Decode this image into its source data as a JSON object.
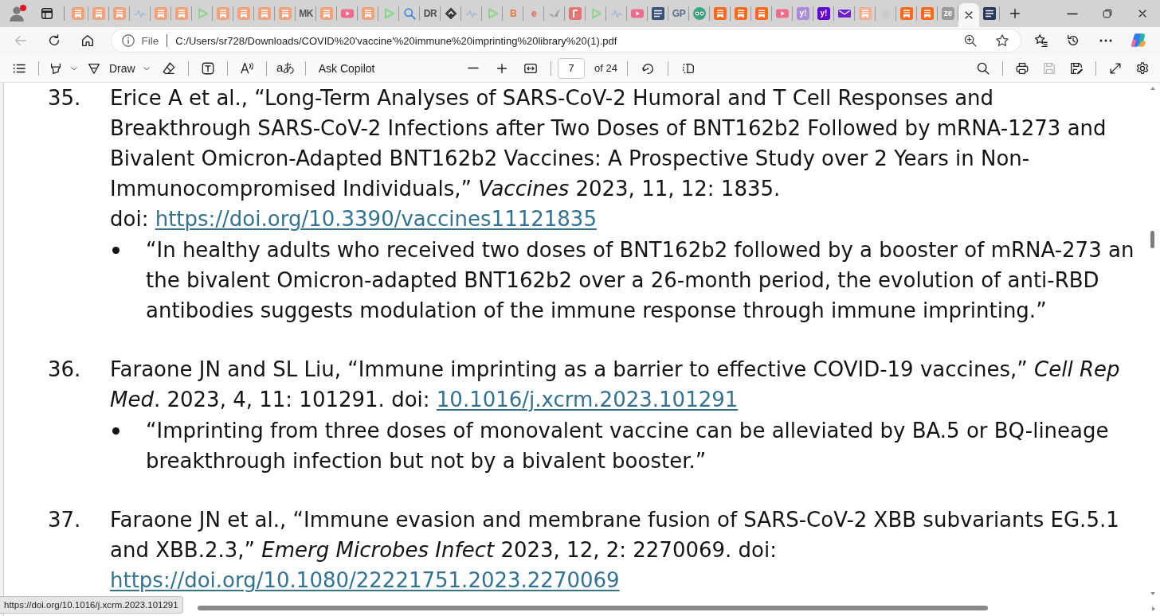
{
  "browser": {
    "profile": {
      "notification": true
    },
    "tabs": [
      {
        "kind": "bookmark",
        "color": "#f4a27a",
        "selected": false
      },
      {
        "kind": "bookmark",
        "color": "#f4a27a",
        "selected": false
      },
      {
        "kind": "bookmark",
        "color": "#f4a27a",
        "selected": false
      },
      {
        "kind": "pulse",
        "color": "#a8b8d8",
        "selected": false
      },
      {
        "kind": "bookmark",
        "color": "#f4a27a",
        "selected": false
      },
      {
        "kind": "bookmark",
        "color": "#f4a27a",
        "selected": false
      },
      {
        "kind": "play",
        "color": "#8fd48c",
        "selected": false
      },
      {
        "kind": "bookmark",
        "color": "#f4a27a",
        "selected": false
      },
      {
        "kind": "bookmark",
        "color": "#f4a27a",
        "selected": false
      },
      {
        "kind": "bookmark",
        "color": "#f4a27a",
        "selected": false
      },
      {
        "kind": "bookmark",
        "color": "#f4a27a",
        "selected": false
      },
      {
        "kind": "letters",
        "text": "MK",
        "color": "#555555",
        "selected": false
      },
      {
        "kind": "bookmark",
        "color": "#f4a27a",
        "selected": false
      },
      {
        "kind": "video",
        "color": "#ee6b8b",
        "selected": false
      },
      {
        "kind": "bookmark",
        "color": "#f4a27a",
        "selected": false
      },
      {
        "kind": "play",
        "color": "#8fd48c",
        "selected": false
      },
      {
        "kind": "search",
        "color": "#4a8ad4",
        "selected": false
      },
      {
        "kind": "letters",
        "text": "DR",
        "color": "#4d4d4d",
        "selected": false
      },
      {
        "kind": "diamond",
        "color": "#3c3c3c",
        "selected": false
      },
      {
        "kind": "pulse",
        "color": "#a8b8d8",
        "selected": false
      },
      {
        "kind": "play",
        "color": "#8fd48c",
        "selected": false
      },
      {
        "kind": "letters",
        "text": "B",
        "color": "#e8773e",
        "selected": false
      },
      {
        "kind": "letters",
        "text": "e",
        "color": "#e2675c",
        "selected": false
      },
      {
        "kind": "bird",
        "color": "#a0a0a0",
        "selected": false
      },
      {
        "kind": "tile",
        "color": "#e57373",
        "selected": false
      },
      {
        "kind": "play",
        "color": "#8fd48c",
        "selected": false
      },
      {
        "kind": "pulse",
        "color": "#a8b8d8",
        "selected": false
      },
      {
        "kind": "video",
        "color": "#ee6b8b",
        "selected": false
      },
      {
        "kind": "news",
        "color": "#3a4f7a",
        "selected": false
      },
      {
        "kind": "letters",
        "text": "GP",
        "color": "#5a6f8c",
        "selected": false
      },
      {
        "kind": "owl",
        "color": "#3aa583",
        "selected": false
      },
      {
        "kind": "bookmark",
        "color": "#ff6719",
        "selected": false
      },
      {
        "kind": "bookmark",
        "color": "#ff6719",
        "selected": false
      },
      {
        "kind": "bookmark",
        "color": "#ff6719",
        "selected": false
      },
      {
        "kind": "video",
        "color": "#ee6b8b",
        "selected": false
      },
      {
        "kind": "letter-tile",
        "text": "y!",
        "color": "#a98bdb",
        "selected": false
      },
      {
        "kind": "letter-tile",
        "text": "y!",
        "color": "#6001d2",
        "selected": false
      },
      {
        "kind": "mail",
        "color": "#6a1fd0",
        "selected": false
      },
      {
        "kind": "bookmark",
        "color": "#f4b08f",
        "selected": false
      },
      {
        "kind": "cross",
        "color": "#c9c9c9",
        "selected": false
      },
      {
        "kind": "bookmark",
        "color": "#ff6719",
        "selected": false
      },
      {
        "kind": "bookmark",
        "color": "#ff6719",
        "selected": false
      },
      {
        "kind": "letter-tile",
        "text": "ze",
        "color": "#9a9a9a",
        "selected": false
      },
      {
        "selected": true
      },
      {
        "kind": "news",
        "color": "#26365e",
        "selected": false
      }
    ]
  },
  "address_bar": {
    "back": {
      "disabled": true
    },
    "scheme": "File",
    "url": "C:/Users/sr728/Downloads/COVID%20'vaccine'%20immune%20imprinting%20library%20(1).pdf"
  },
  "pdf_toolbar": {
    "draw_label": "Draw",
    "translate_label": "aあ",
    "copilot_label": "Ask Copilot",
    "page": "7",
    "page_total": "of 24",
    "save": {
      "disabled": true
    }
  },
  "document": {
    "references": [
      {
        "number": "35.",
        "lines": [
          {
            "text": "Erice A et al., “Long-Term Analyses of SARS-CoV-2 Humoral and T Cell Responses and"
          },
          {
            "text": "Breakthrough SARS-CoV-2 Infections after Two Doses of BNT162b2 Followed by mRNA-1273 and"
          },
          {
            "text": "Bivalent Omicron-Adapted BNT162b2 Vaccines: A Prospective Study over 2 Years in Non-"
          },
          {
            "text": "Immunocompromised Individuals,” *Vaccines* 2023, 11, 12: 1835."
          },
          {
            "text": "doi:",
            "link": "https://doi.org/10.3390/vaccines11121835"
          }
        ],
        "bullets": [
          {
            "lines": [
              "“In healthy adults who received two doses of BNT162b2 followed by a booster of mRNA-273 an",
              "the bivalent Omicron-adapted BNT162b2 over a 26-month period, the evolution of anti-RBD",
              "antibodies suggests modulation of the immune response through immune imprinting.”"
            ]
          }
        ]
      },
      {
        "number": "36.",
        "lines": [
          {
            "text": "Faraone JN and SL Liu, “Immune imprinting as a barrier to effective COVID-19 vaccines,” *Cell Rep*"
          },
          {
            "text": "*Med*. 2023, 4, 11: 101291. doi:",
            "link": "10.1016/j.xcrm.2023.101291"
          }
        ],
        "bullets": [
          {
            "lines": [
              "“Imprinting from three doses of monovalent vaccine can be alleviated by BA.5 or BQ-lineage",
              "breakthrough infection but not by a bivalent booster.”"
            ]
          }
        ]
      },
      {
        "number": "37.",
        "lines": [
          {
            "text": "Faraone JN et al., “Immune evasion and membrane fusion of SARS-CoV-2 XBB subvariants EG.5.1"
          },
          {
            "text": "and XBB.2.3,” *Emerg Microbes Infect* 2023, 12, 2: 2270069. doi:"
          },
          {
            "link": "https://doi.org/10.1080/22221751.2023.2270069"
          }
        ]
      }
    ]
  },
  "status_link": "https://doi.org/10.1016/j.xcrm.2023.101291"
}
